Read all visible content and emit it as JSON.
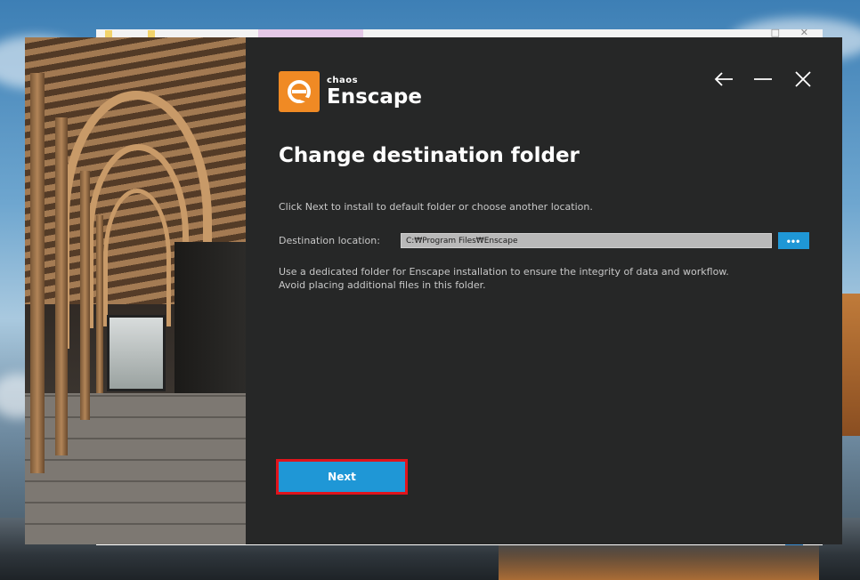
{
  "app": {
    "brand_small": "chaos",
    "brand_name": "Enscape"
  },
  "page": {
    "title": "Change destination folder",
    "intro": "Click Next to install to default folder or choose another location.",
    "destination_label": "Destination location:",
    "destination_value": "C:₩Program Files₩Enscape",
    "browse_label": "•••",
    "note_line1": "Use a dedicated folder for Enscape installation to ensure the integrity of data and workflow.",
    "note_line2": "Avoid placing additional files in this folder."
  },
  "footer": {
    "next_label": "Next"
  },
  "icons": {
    "back": "arrow-left-icon",
    "minimize": "minimize-icon",
    "close": "close-icon",
    "logo": "enscape-logo-icon"
  },
  "colors": {
    "accent": "#1f97d6",
    "brand_orange": "#f08a24",
    "highlight": "#e0141c",
    "dialog_bg": "#262727"
  }
}
